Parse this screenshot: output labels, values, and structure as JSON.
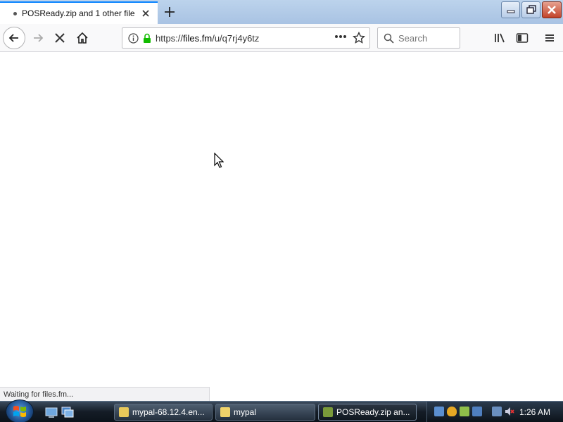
{
  "tab": {
    "title": "POSReady.zip and 1 other file |"
  },
  "navbar": {
    "url_scheme": "https://",
    "url_host": "files.fm",
    "url_path": "/u/q7rj4y6tz",
    "search_placeholder": "Search"
  },
  "status_text": "Waiting for files.fm...",
  "taskbar": {
    "tasks": [
      {
        "label": "mypal-68.12.4.en..."
      },
      {
        "label": "mypal"
      },
      {
        "label": "POSReady.zip an..."
      }
    ],
    "clock": "1:26 AM"
  },
  "colors": {
    "accent_tab": "#0a84ff",
    "lock_green": "#12bc00"
  }
}
